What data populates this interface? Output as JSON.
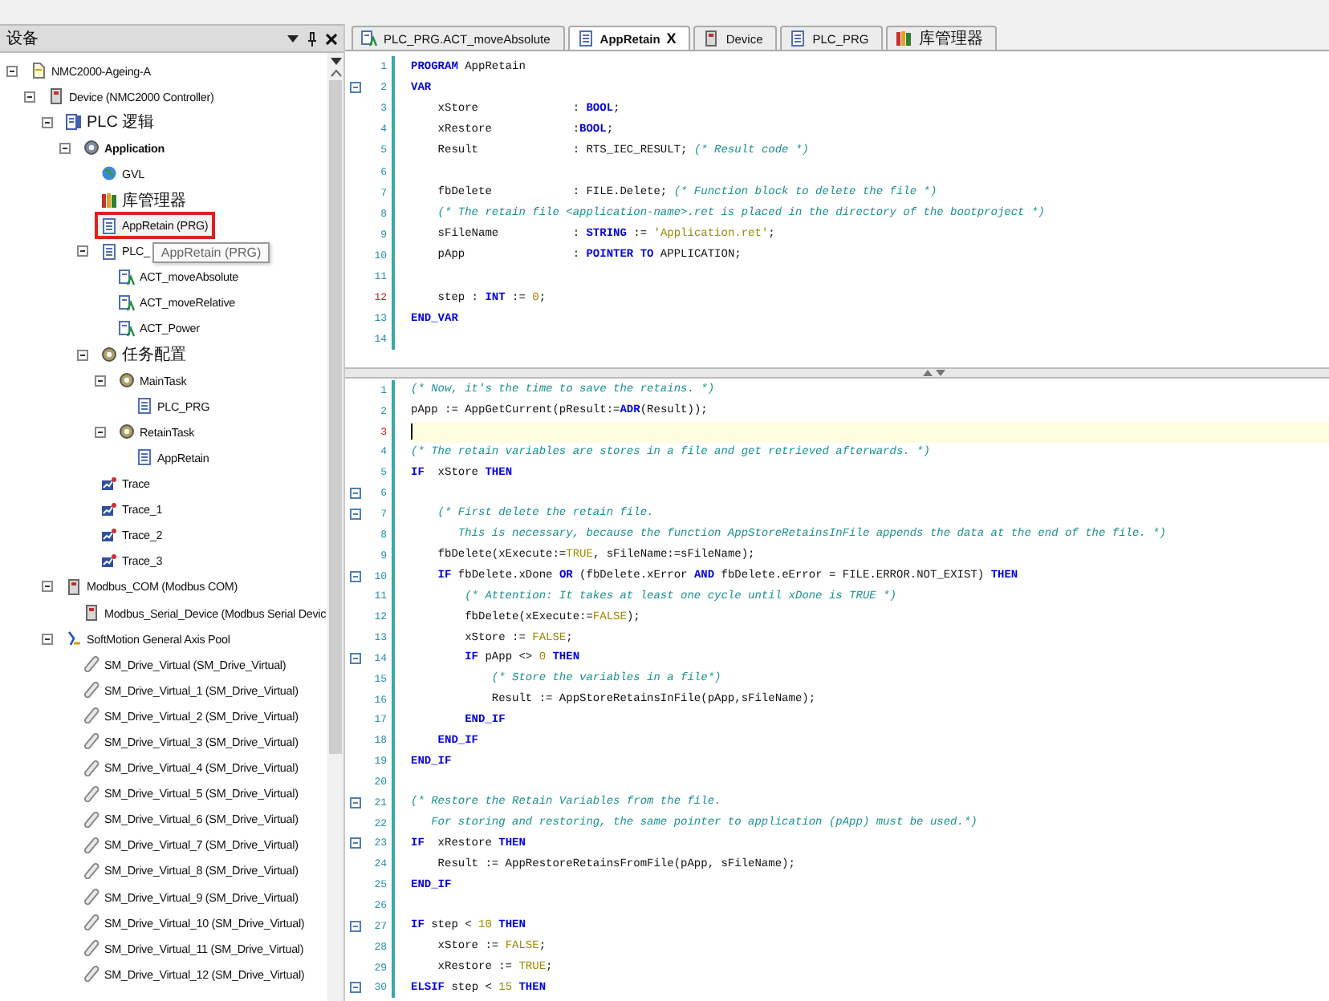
{
  "device_panel": {
    "title": "设备"
  },
  "tree": [
    {
      "label": "NMC2000-Ageing-A",
      "kind": "project",
      "expanded": true,
      "selected": false,
      "children": [
        {
          "label": "Device (NMC2000 Controller)",
          "kind": "device",
          "expanded": true,
          "selected": false,
          "children": [
            {
              "label": "PLC 逻辑",
              "kind": "plc",
              "expanded": true,
              "selected": false,
              "children": [
                {
                  "label": "Application",
                  "kind": "application",
                  "expanded": true,
                  "selected": false,
                  "children": [
                    {
                      "label": "GVL",
                      "kind": "gvl",
                      "selected": false
                    },
                    {
                      "label": "库管理器",
                      "kind": "library",
                      "selected": false
                    },
                    {
                      "label": "AppRetain (PRG)",
                      "kind": "pou",
                      "selected": true
                    },
                    {
                      "label": "PLC_",
                      "kind": "pou",
                      "expanded": true,
                      "selected": false,
                      "tooltip": "AppRetain (PRG)",
                      "children": [
                        {
                          "label": "ACT_moveAbsolute",
                          "kind": "action",
                          "selected": false
                        },
                        {
                          "label": "ACT_moveRelative",
                          "kind": "action",
                          "selected": false
                        },
                        {
                          "label": "ACT_Power",
                          "kind": "action",
                          "selected": false
                        }
                      ]
                    },
                    {
                      "label": "任务配置",
                      "kind": "taskconfig",
                      "expanded": true,
                      "selected": false,
                      "children": [
                        {
                          "label": "MainTask",
                          "kind": "task",
                          "expanded": true,
                          "selected": false,
                          "children": [
                            {
                              "label": "PLC_PRG",
                              "kind": "taskcall",
                              "selected": false
                            }
                          ]
                        },
                        {
                          "label": "RetainTask",
                          "kind": "task",
                          "expanded": true,
                          "selected": false,
                          "children": [
                            {
                              "label": "AppRetain",
                              "kind": "taskcall",
                              "selected": false
                            }
                          ]
                        }
                      ]
                    },
                    {
                      "label": "Trace",
                      "kind": "trace",
                      "selected": false
                    },
                    {
                      "label": "Trace_1",
                      "kind": "trace",
                      "selected": false
                    },
                    {
                      "label": "Trace_2",
                      "kind": "trace",
                      "selected": false
                    },
                    {
                      "label": "Trace_3",
                      "kind": "trace",
                      "selected": false
                    }
                  ]
                }
              ]
            },
            {
              "label": "Modbus_COM (Modbus COM)",
              "kind": "device",
              "expanded": true,
              "selected": false,
              "children": [
                {
                  "label": "Modbus_Serial_Device (Modbus Serial Devic",
                  "kind": "device",
                  "selected": false
                }
              ]
            },
            {
              "label": "SoftMotion General Axis Pool",
              "kind": "axispool",
              "expanded": true,
              "selected": false,
              "children": [
                {
                  "label": "SM_Drive_Virtual (SM_Drive_Virtual)",
                  "kind": "axis",
                  "selected": false
                },
                {
                  "label": "SM_Drive_Virtual_1 (SM_Drive_Virtual)",
                  "kind": "axis",
                  "selected": false
                },
                {
                  "label": "SM_Drive_Virtual_2 (SM_Drive_Virtual)",
                  "kind": "axis",
                  "selected": false
                },
                {
                  "label": "SM_Drive_Virtual_3 (SM_Drive_Virtual)",
                  "kind": "axis",
                  "selected": false
                },
                {
                  "label": "SM_Drive_Virtual_4 (SM_Drive_Virtual)",
                  "kind": "axis",
                  "selected": false
                },
                {
                  "label": "SM_Drive_Virtual_5 (SM_Drive_Virtual)",
                  "kind": "axis",
                  "selected": false
                },
                {
                  "label": "SM_Drive_Virtual_6 (SM_Drive_Virtual)",
                  "kind": "axis",
                  "selected": false
                },
                {
                  "label": "SM_Drive_Virtual_7 (SM_Drive_Virtual)",
                  "kind": "axis",
                  "selected": false
                },
                {
                  "label": "SM_Drive_Virtual_8 (SM_Drive_Virtual)",
                  "kind": "axis",
                  "selected": false
                },
                {
                  "label": "SM_Drive_Virtual_9 (SM_Drive_Virtual)",
                  "kind": "axis",
                  "selected": false
                },
                {
                  "label": "SM_Drive_Virtual_10 (SM_Drive_Virtual)",
                  "kind": "axis",
                  "selected": false
                },
                {
                  "label": "SM_Drive_Virtual_11 (SM_Drive_Virtual)",
                  "kind": "axis",
                  "selected": false
                },
                {
                  "label": "SM_Drive_Virtual_12 (SM_Drive_Virtual)",
                  "kind": "axis",
                  "selected": false
                }
              ]
            }
          ]
        }
      ]
    }
  ],
  "editor_tabs": [
    {
      "label": "PLC_PRG.ACT_moveAbsolute",
      "kind": "action",
      "selected": false
    },
    {
      "label": "AppRetain",
      "kind": "pou",
      "selected": true,
      "close": "X"
    },
    {
      "label": "Device",
      "kind": "device",
      "selected": false
    },
    {
      "label": "PLC_PRG",
      "kind": "pou",
      "selected": false
    },
    {
      "label": "库管理器",
      "kind": "library",
      "selected": false
    }
  ],
  "declaration_lines": [
    {
      "number": "1",
      "fold": false,
      "marked": false,
      "current": false,
      "tokens": [
        {
          "kind": "keyword",
          "text": "PROGRAM"
        },
        {
          "kind": "plain",
          "text": " AppRetain"
        }
      ]
    },
    {
      "number": "2",
      "fold": true,
      "marked": false,
      "current": false,
      "tokens": [
        {
          "kind": "keyword",
          "text": "VAR"
        }
      ]
    },
    {
      "number": "3",
      "fold": false,
      "marked": false,
      "current": false,
      "tokens": [
        {
          "kind": "plain",
          "text": "    xStore              : "
        },
        {
          "kind": "keyword",
          "text": "BOOL"
        },
        {
          "kind": "plain",
          "text": ";"
        }
      ]
    },
    {
      "number": "4",
      "fold": false,
      "marked": false,
      "current": false,
      "tokens": [
        {
          "kind": "plain",
          "text": "    xRestore            :"
        },
        {
          "kind": "keyword",
          "text": "BOOL"
        },
        {
          "kind": "plain",
          "text": ";"
        }
      ]
    },
    {
      "number": "5",
      "fold": false,
      "marked": false,
      "current": false,
      "tokens": [
        {
          "kind": "plain",
          "text": "    Result              : RTS_IEC_RESULT; "
        },
        {
          "kind": "comment",
          "text": "(* Result code *)"
        }
      ]
    },
    {
      "number": "6",
      "fold": false,
      "marked": false,
      "current": false
    },
    {
      "number": "7",
      "fold": false,
      "marked": false,
      "current": false,
      "tokens": [
        {
          "kind": "plain",
          "text": "    fbDelete            : FILE.Delete; "
        },
        {
          "kind": "comment",
          "text": "(* Function block to delete the file *)"
        }
      ]
    },
    {
      "number": "8",
      "fold": false,
      "marked": false,
      "current": false,
      "tokens": [
        {
          "kind": "comment",
          "text": "    (* The retain file <application-name>.ret is placed in the directory of the bootproject *)"
        }
      ]
    },
    {
      "number": "9",
      "fold": false,
      "marked": false,
      "current": false,
      "tokens": [
        {
          "kind": "plain",
          "text": "    sFileName           : "
        },
        {
          "kind": "keyword",
          "text": "STRING"
        },
        {
          "kind": "plain",
          "text": " := "
        },
        {
          "kind": "literal",
          "text": "'Application.ret'"
        },
        {
          "kind": "plain",
          "text": ";"
        }
      ]
    },
    {
      "number": "10",
      "fold": false,
      "marked": false,
      "current": false,
      "tokens": [
        {
          "kind": "plain",
          "text": "    pApp                : "
        },
        {
          "kind": "keyword",
          "text": "POINTER TO"
        },
        {
          "kind": "plain",
          "text": " APPLICATION;"
        }
      ]
    },
    {
      "number": "11",
      "fold": false,
      "marked": false,
      "current": false
    },
    {
      "number": "12",
      "fold": false,
      "marked": true,
      "current": false,
      "tokens": [
        {
          "kind": "plain",
          "text": "    step : "
        },
        {
          "kind": "keyword",
          "text": "INT"
        },
        {
          "kind": "plain",
          "text": " := "
        },
        {
          "kind": "literal",
          "text": "0"
        },
        {
          "kind": "plain",
          "text": ";"
        }
      ]
    },
    {
      "number": "13",
      "fold": false,
      "marked": false,
      "current": false,
      "tokens": [
        {
          "kind": "keyword",
          "text": "END_VAR"
        }
      ]
    },
    {
      "number": "14",
      "fold": false,
      "marked": false,
      "current": false
    }
  ],
  "implementation_lines": [
    {
      "number": "1",
      "fold": false,
      "marked": false,
      "current": false,
      "tokens": [
        {
          "kind": "comment",
          "text": "(* Now, it's the time to save the retains. *)"
        }
      ]
    },
    {
      "number": "2",
      "fold": false,
      "marked": false,
      "current": false,
      "tokens": [
        {
          "kind": "plain",
          "text": "pApp := AppGetCurrent(pResult:="
        },
        {
          "kind": "keyword",
          "text": "ADR"
        },
        {
          "kind": "plain",
          "text": "(Result));"
        }
      ]
    },
    {
      "number": "3",
      "fold": false,
      "marked": true,
      "current": true
    },
    {
      "number": "4",
      "fold": false,
      "marked": false,
      "current": false,
      "tokens": [
        {
          "kind": "comment",
          "text": "(* The retain variables are stores in a file and get retrieved afterwards. *)"
        }
      ]
    },
    {
      "number": "5",
      "fold": false,
      "marked": false,
      "current": false,
      "tokens": [
        {
          "kind": "keyword",
          "text": "IF"
        },
        {
          "kind": "plain",
          "text": "  xStore "
        },
        {
          "kind": "keyword",
          "text": "THEN"
        }
      ]
    },
    {
      "number": "6",
      "fold": true,
      "marked": false,
      "current": false
    },
    {
      "number": "7",
      "fold": true,
      "marked": false,
      "current": false,
      "tokens": [
        {
          "kind": "comment",
          "text": "    (* First delete the retain file."
        }
      ]
    },
    {
      "number": "8",
      "fold": false,
      "marked": false,
      "current": false,
      "tokens": [
        {
          "kind": "comment",
          "text": "       This is necessary, because the function AppStoreRetainsInFile appends the data at the end of the file. *)"
        }
      ]
    },
    {
      "number": "9",
      "fold": false,
      "marked": false,
      "current": false,
      "tokens": [
        {
          "kind": "plain",
          "text": "    fbDelete(xExecute:="
        },
        {
          "kind": "literal",
          "text": "TRUE"
        },
        {
          "kind": "plain",
          "text": ", sFileName:=sFileName);"
        }
      ]
    },
    {
      "number": "10",
      "fold": true,
      "marked": false,
      "current": false,
      "tokens": [
        {
          "kind": "keyword",
          "text": "    IF"
        },
        {
          "kind": "plain",
          "text": " fbDelete.xDone "
        },
        {
          "kind": "keyword",
          "text": "OR"
        },
        {
          "kind": "plain",
          "text": " (fbDelete.xError "
        },
        {
          "kind": "keyword",
          "text": "AND"
        },
        {
          "kind": "plain",
          "text": " fbDelete.eError = FILE.ERROR.NOT_EXIST) "
        },
        {
          "kind": "keyword",
          "text": "THEN"
        }
      ]
    },
    {
      "number": "11",
      "fold": false,
      "marked": false,
      "current": false,
      "tokens": [
        {
          "kind": "comment",
          "text": "        (* Attention: It takes at least one cycle until xDone is TRUE *)"
        }
      ]
    },
    {
      "number": "12",
      "fold": false,
      "marked": false,
      "current": false,
      "tokens": [
        {
          "kind": "plain",
          "text": "        fbDelete(xExecute:="
        },
        {
          "kind": "literal",
          "text": "FALSE"
        },
        {
          "kind": "plain",
          "text": ");"
        }
      ]
    },
    {
      "number": "13",
      "fold": false,
      "marked": false,
      "current": false,
      "tokens": [
        {
          "kind": "plain",
          "text": "        xStore := "
        },
        {
          "kind": "literal",
          "text": "FALSE"
        },
        {
          "kind": "plain",
          "text": ";"
        }
      ]
    },
    {
      "number": "14",
      "fold": true,
      "marked": false,
      "current": false,
      "tokens": [
        {
          "kind": "keyword",
          "text": "        IF"
        },
        {
          "kind": "plain",
          "text": " pApp <> "
        },
        {
          "kind": "literal",
          "text": "0"
        },
        {
          "kind": "keyword",
          "text": " THEN"
        }
      ]
    },
    {
      "number": "15",
      "fold": false,
      "marked": false,
      "current": false,
      "tokens": [
        {
          "kind": "comment",
          "text": "            (* Store the variables in a file*)"
        }
      ]
    },
    {
      "number": "16",
      "fold": false,
      "marked": false,
      "current": false,
      "tokens": [
        {
          "kind": "plain",
          "text": "            Result := AppStoreRetainsInFile(pApp,sFileName);"
        }
      ]
    },
    {
      "number": "17",
      "fold": false,
      "marked": false,
      "current": false,
      "tokens": [
        {
          "kind": "keyword",
          "text": "        END_IF"
        }
      ]
    },
    {
      "number": "18",
      "fold": false,
      "marked": false,
      "current": false,
      "tokens": [
        {
          "kind": "keyword",
          "text": "    END_IF"
        }
      ]
    },
    {
      "number": "19",
      "fold": false,
      "marked": false,
      "current": false,
      "tokens": [
        {
          "kind": "keyword",
          "text": "END_IF"
        }
      ]
    },
    {
      "number": "20",
      "fold": false,
      "marked": false,
      "current": false
    },
    {
      "number": "21",
      "fold": true,
      "marked": false,
      "current": false,
      "tokens": [
        {
          "kind": "comment",
          "text": "(* Restore the Retain Variables from the file."
        }
      ]
    },
    {
      "number": "22",
      "fold": false,
      "marked": false,
      "current": false,
      "tokens": [
        {
          "kind": "comment",
          "text": "   For storing and restoring, the same pointer to application (pApp) must be used.*)"
        }
      ]
    },
    {
      "number": "23",
      "fold": true,
      "marked": false,
      "current": false,
      "tokens": [
        {
          "kind": "keyword",
          "text": "IF"
        },
        {
          "kind": "plain",
          "text": "  xRestore "
        },
        {
          "kind": "keyword",
          "text": "THEN"
        }
      ]
    },
    {
      "number": "24",
      "fold": false,
      "marked": false,
      "current": false,
      "tokens": [
        {
          "kind": "plain",
          "text": "    Result := AppRestoreRetainsFromFile(pApp, sFileName);"
        }
      ]
    },
    {
      "number": "25",
      "fold": false,
      "marked": false,
      "current": false,
      "tokens": [
        {
          "kind": "keyword",
          "text": "END_IF"
        }
      ]
    },
    {
      "number": "26",
      "fold": false,
      "marked": false,
      "current": false
    },
    {
      "number": "27",
      "fold": true,
      "marked": false,
      "current": false,
      "tokens": [
        {
          "kind": "keyword",
          "text": "IF"
        },
        {
          "kind": "plain",
          "text": " step < "
        },
        {
          "kind": "literal",
          "text": "10"
        },
        {
          "kind": "keyword",
          "text": " THEN"
        }
      ]
    },
    {
      "number": "28",
      "fold": false,
      "marked": false,
      "current": false,
      "tokens": [
        {
          "kind": "plain",
          "text": "    xStore := "
        },
        {
          "kind": "literal",
          "text": "FALSE"
        },
        {
          "kind": "plain",
          "text": ";"
        }
      ]
    },
    {
      "number": "29",
      "fold": false,
      "marked": false,
      "current": false,
      "tokens": [
        {
          "kind": "plain",
          "text": "    xRestore := "
        },
        {
          "kind": "literal",
          "text": "TRUE"
        },
        {
          "kind": "plain",
          "text": ";"
        }
      ]
    },
    {
      "number": "30",
      "fold": true,
      "marked": false,
      "current": false,
      "tokens": [
        {
          "kind": "keyword",
          "text": "ELSIF"
        },
        {
          "kind": "plain",
          "text": " step < "
        },
        {
          "kind": "literal",
          "text": "15"
        },
        {
          "kind": "keyword",
          "text": " THEN"
        }
      ]
    }
  ]
}
